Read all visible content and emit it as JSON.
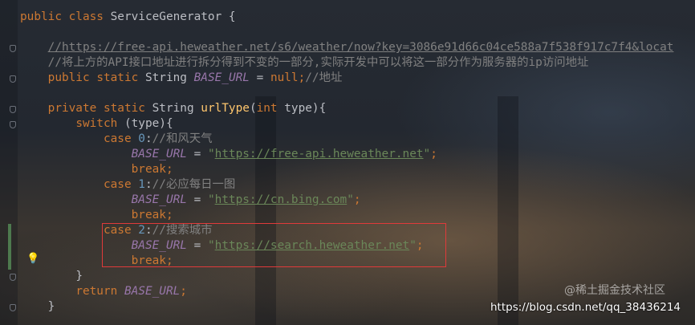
{
  "editor": {
    "lines": [
      {
        "indent": 0,
        "tokens": [
          {
            "t": "public class ",
            "c": "kw"
          },
          {
            "t": "ServiceGenerator {",
            "c": ""
          }
        ]
      },
      {
        "indent": 0,
        "tokens": []
      },
      {
        "indent": 1,
        "tokens": [
          {
            "t": "//https://free-api.heweather.net/s6/weather/now?key=3086e91d66c04ce588a7f538f917c7f4&locat",
            "c": "cmt link"
          }
        ]
      },
      {
        "indent": 1,
        "tokens": [
          {
            "t": "//将上方的API接口地址进行拆分得到不变的一部分,实际开发中可以将这一部分作为服务器的ip访问地址",
            "c": "cmt"
          }
        ]
      },
      {
        "indent": 1,
        "tokens": [
          {
            "t": "public ",
            "c": "kw"
          },
          {
            "t": "static ",
            "c": "kw"
          },
          {
            "t": "String ",
            "c": ""
          },
          {
            "t": "BASE_URL",
            "c": "const"
          },
          {
            "t": " = ",
            "c": ""
          },
          {
            "t": "null",
            "c": "kw"
          },
          {
            "t": ";",
            "c": "kw"
          },
          {
            "t": "//地址",
            "c": "cmt"
          }
        ]
      },
      {
        "indent": 0,
        "tokens": []
      },
      {
        "indent": 1,
        "tokens": [
          {
            "t": "private ",
            "c": "kw"
          },
          {
            "t": "static ",
            "c": "kw"
          },
          {
            "t": "String ",
            "c": ""
          },
          {
            "t": "urlType",
            "c": "fn"
          },
          {
            "t": "(",
            "c": ""
          },
          {
            "t": "int ",
            "c": "kw"
          },
          {
            "t": "type){",
            "c": ""
          }
        ]
      },
      {
        "indent": 2,
        "tokens": [
          {
            "t": "switch ",
            "c": "kw"
          },
          {
            "t": "(type){",
            "c": ""
          }
        ]
      },
      {
        "indent": 3,
        "tokens": [
          {
            "t": "case ",
            "c": "kw"
          },
          {
            "t": "0",
            "c": "num"
          },
          {
            "t": ":",
            "c": ""
          },
          {
            "t": "//和风天气",
            "c": "cmt"
          }
        ]
      },
      {
        "indent": 4,
        "tokens": [
          {
            "t": "BASE_URL",
            "c": "const"
          },
          {
            "t": " = ",
            "c": ""
          },
          {
            "t": "\"",
            "c": "str"
          },
          {
            "t": "https://free-api.heweather.net",
            "c": "str link"
          },
          {
            "t": "\"",
            "c": "str"
          },
          {
            "t": ";",
            "c": "kw"
          }
        ]
      },
      {
        "indent": 4,
        "tokens": [
          {
            "t": "break",
            "c": "kw"
          },
          {
            "t": ";",
            "c": "kw"
          }
        ]
      },
      {
        "indent": 3,
        "tokens": [
          {
            "t": "case ",
            "c": "kw"
          },
          {
            "t": "1",
            "c": "num"
          },
          {
            "t": ":",
            "c": ""
          },
          {
            "t": "//必应每日一图",
            "c": "cmt"
          }
        ]
      },
      {
        "indent": 4,
        "tokens": [
          {
            "t": "BASE_URL",
            "c": "const"
          },
          {
            "t": " = ",
            "c": ""
          },
          {
            "t": "\"",
            "c": "str"
          },
          {
            "t": "https://cn.bing.com",
            "c": "str link"
          },
          {
            "t": "\"",
            "c": "str"
          },
          {
            "t": ";",
            "c": "kw"
          }
        ]
      },
      {
        "indent": 4,
        "tokens": [
          {
            "t": "break",
            "c": "kw"
          },
          {
            "t": ";",
            "c": "kw"
          }
        ]
      },
      {
        "indent": 3,
        "tokens": [
          {
            "t": "case ",
            "c": "kw"
          },
          {
            "t": "2",
            "c": "num"
          },
          {
            "t": ":",
            "c": ""
          },
          {
            "t": "//搜索城市",
            "c": "cmt"
          }
        ]
      },
      {
        "indent": 4,
        "tokens": [
          {
            "t": "BASE_URL",
            "c": "const"
          },
          {
            "t": " = ",
            "c": ""
          },
          {
            "t": "\"",
            "c": "str"
          },
          {
            "t": "https://search.heweather.net",
            "c": "str link"
          },
          {
            "t": "\"",
            "c": "str"
          },
          {
            "t": ";",
            "c": "kw"
          }
        ]
      },
      {
        "indent": 4,
        "tokens": [
          {
            "t": "break",
            "c": "kw"
          },
          {
            "t": ";",
            "c": "kw"
          }
        ]
      },
      {
        "indent": 2,
        "tokens": [
          {
            "t": "}",
            "c": ""
          }
        ]
      },
      {
        "indent": 2,
        "tokens": [
          {
            "t": "return ",
            "c": "kw"
          },
          {
            "t": "BASE_URL",
            "c": "const"
          },
          {
            "t": ";",
            "c": "kw"
          }
        ]
      },
      {
        "indent": 1,
        "tokens": [
          {
            "t": "}",
            "c": ""
          }
        ]
      }
    ]
  },
  "watermark": {
    "site_logo_text": "@稀土掘金技术社区",
    "url": "https://blog.csdn.net/qq_38436214"
  },
  "colors": {
    "keyword": "#cc7832",
    "number": "#6897bb",
    "string": "#6a8759",
    "comment": "#808080",
    "constant": "#9876aa",
    "method": "#ffc66d",
    "highlight_box": "#e03a3a"
  },
  "icons": {
    "intention_bulb": "lightbulb-icon",
    "fold_marker": "fold-icon"
  }
}
